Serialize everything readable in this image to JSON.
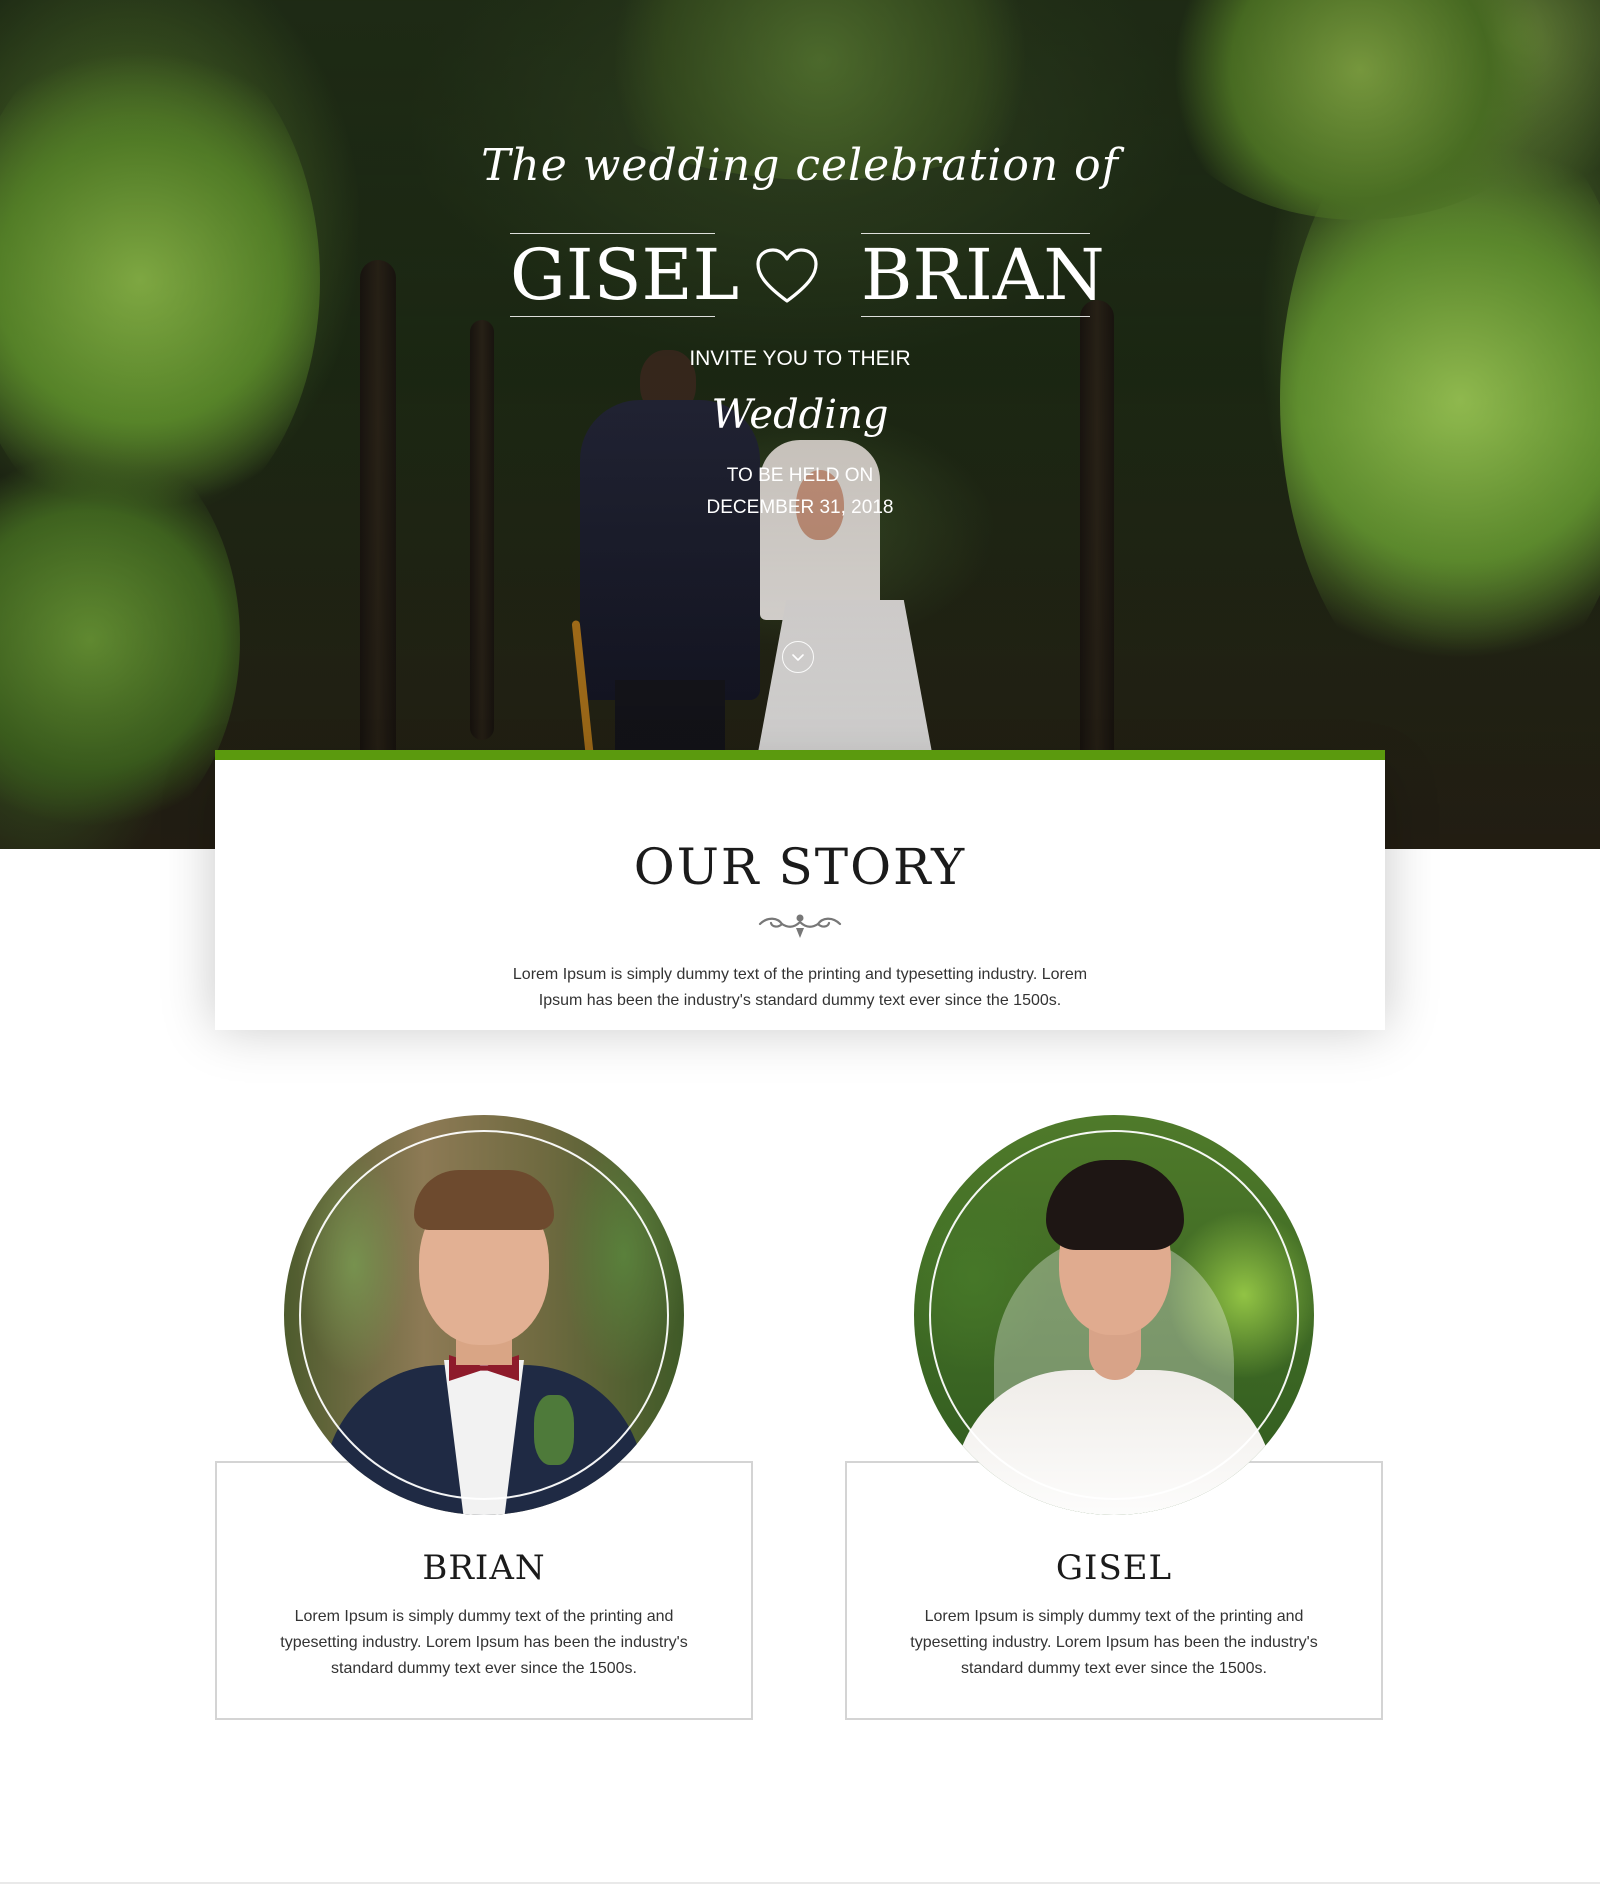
{
  "hero": {
    "script_title": "The wedding celebration of",
    "name_left": "GISEL",
    "name_right": "BRIAN",
    "heart_icon": "heart-outline-icon",
    "invite_line": "INVITE YOU TO THEIR",
    "wedding_script": "Wedding",
    "held_line": "TO BE HELD ON",
    "date_line": "DECEMBER 31, 2018",
    "scroll_icon": "chevron-down-icon"
  },
  "story": {
    "title": "OUR STORY",
    "ornament_icon": "flourish-divider-icon",
    "text": "Lorem Ipsum is simply dummy text of the printing and typesetting industry. Lorem Ipsum has been the industry's standard dummy text ever since the 1500s.",
    "accent_color": "#5b9a0e"
  },
  "profiles": [
    {
      "name": "BRIAN",
      "text": "Lorem Ipsum is simply dummy text of the printing and typesetting industry. Lorem Ipsum has been the industry's standard dummy text ever since the 1500s."
    },
    {
      "name": "GISEL",
      "text": "Lorem Ipsum is simply dummy text of the printing and typesetting industry. Lorem Ipsum has been the industry's standard dummy text ever since the 1500s."
    }
  ]
}
